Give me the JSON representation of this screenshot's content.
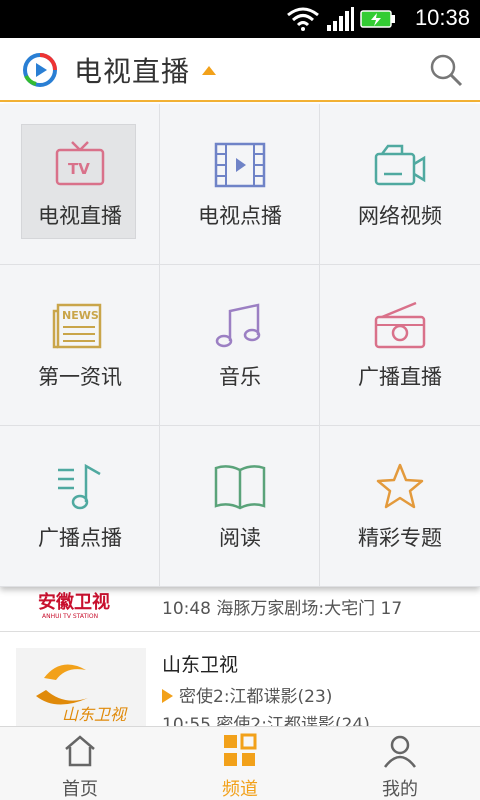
{
  "status_bar": {
    "time": "10:38"
  },
  "header": {
    "title": "电视直播"
  },
  "menu": {
    "items": [
      {
        "label": "电视直播",
        "icon": "tv-icon",
        "color": "#d9718a",
        "selected": true
      },
      {
        "label": "电视点播",
        "icon": "film-strip-icon",
        "color": "#6f83c7",
        "selected": false
      },
      {
        "label": "网络视频",
        "icon": "video-camera-icon",
        "color": "#4fa9a0",
        "selected": false
      },
      {
        "label": "第一资讯",
        "icon": "newspaper-icon",
        "color": "#c9a54a",
        "selected": false
      },
      {
        "label": "音乐",
        "icon": "music-note-icon",
        "color": "#9b7fc3",
        "selected": false
      },
      {
        "label": "广播直播",
        "icon": "radio-icon",
        "color": "#d9718a",
        "selected": false
      },
      {
        "label": "广播点播",
        "icon": "music-list-icon",
        "color": "#4fa9a0",
        "selected": false
      },
      {
        "label": "阅读",
        "icon": "book-icon",
        "color": "#5aa37a",
        "selected": false
      },
      {
        "label": "精彩专题",
        "icon": "star-icon",
        "color": "#e39a3c",
        "selected": false
      }
    ]
  },
  "list": {
    "rows": [
      {
        "logo_text": "安徽卫视",
        "logo_subtext": "ANHUI TV STATION",
        "program": "10:48 海豚万家剧场:大宅门 17"
      },
      {
        "channel": "山东卫视",
        "logo_text": "山东卫视",
        "now": "密使2:江都谍影(23)",
        "next": "10:55 密使2:江都谍影(24)"
      }
    ]
  },
  "bottom_nav": {
    "tabs": [
      {
        "label": "首页",
        "icon": "home-icon",
        "active": false
      },
      {
        "label": "频道",
        "icon": "grid-icon",
        "active": true
      },
      {
        "label": "我的",
        "icon": "user-icon",
        "active": false
      }
    ]
  },
  "accent_color": "#f2a11a"
}
